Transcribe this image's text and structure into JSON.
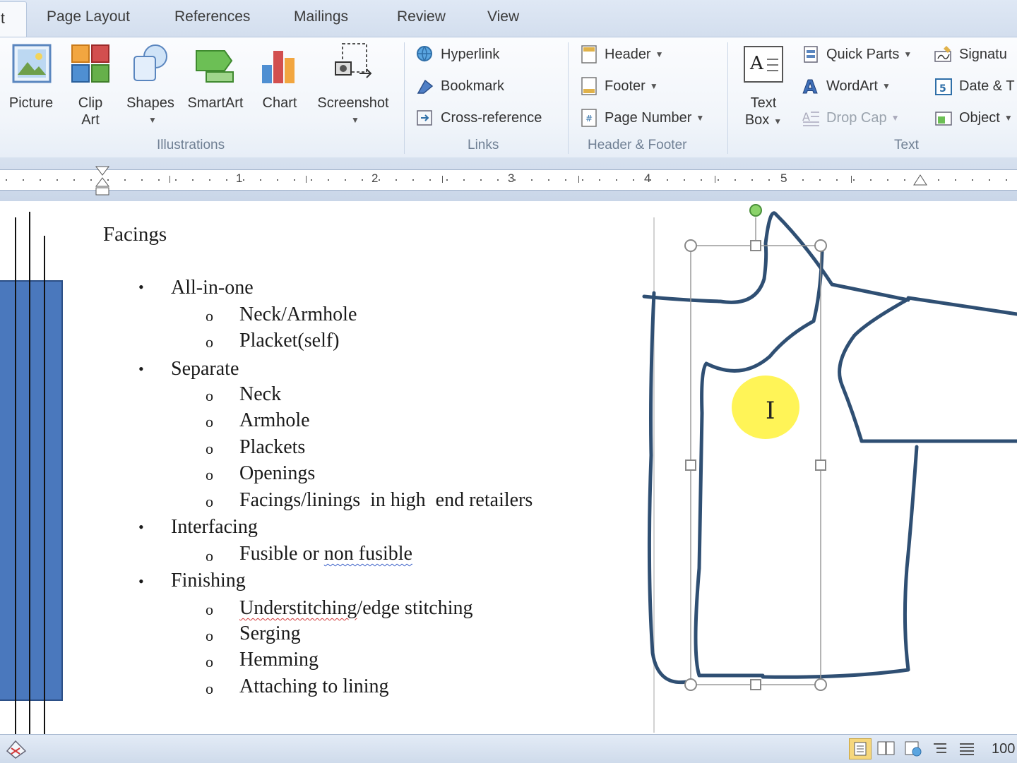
{
  "tabs": {
    "active": "t",
    "items": [
      "Page Layout",
      "References",
      "Mailings",
      "Review",
      "View"
    ]
  },
  "ribbon": {
    "illustrations": {
      "label": "Illustrations",
      "picture": "Picture",
      "clipart_1": "Clip",
      "clipart_2": "Art",
      "shapes": "Shapes",
      "smartart": "SmartArt",
      "chart": "Chart",
      "screenshot": "Screenshot"
    },
    "links": {
      "label": "Links",
      "hyperlink": "Hyperlink",
      "bookmark": "Bookmark",
      "crossref": "Cross-reference"
    },
    "header_footer": {
      "label": "Header & Footer",
      "header": "Header",
      "footer": "Footer",
      "page_number": "Page Number"
    },
    "text": {
      "label": "Text",
      "textbox_1": "Text",
      "textbox_2": "Box",
      "quick_parts": "Quick Parts",
      "wordart": "WordArt",
      "drop_cap": "Drop Cap",
      "signature": "Signatu",
      "date": "Date & T",
      "object": "Object"
    }
  },
  "ruler": {
    "numbers": [
      "1",
      "2",
      "3",
      "4",
      "5"
    ]
  },
  "document": {
    "heading": "Facings",
    "items": [
      {
        "level": 1,
        "text": "All-in-one"
      },
      {
        "level": 2,
        "text": "Neck/Armhole"
      },
      {
        "level": 2,
        "text": "Placket(self)"
      },
      {
        "level": 1,
        "text": "Separate"
      },
      {
        "level": 2,
        "text": "Neck"
      },
      {
        "level": 2,
        "text": "Armhole"
      },
      {
        "level": 2,
        "text": "Plackets"
      },
      {
        "level": 2,
        "text": "Openings"
      },
      {
        "level": 2,
        "text": "Facings/linings  in high  end retailers"
      },
      {
        "level": 1,
        "text": "Interfacing"
      },
      {
        "level": 2,
        "text_a": "Fusible or ",
        "text_b": "non fusible"
      },
      {
        "level": 1,
        "text": "Finishing"
      },
      {
        "level": 2,
        "text_a": "Understitching",
        "text_b": "/edge stitching"
      },
      {
        "level": 2,
        "text": "Serging"
      },
      {
        "level": 2,
        "text": "Hemming"
      },
      {
        "level": 2,
        "text": "Attaching to lining"
      }
    ],
    "bullet_l1": "•",
    "bullet_l2": "o"
  },
  "statusbar": {
    "zoom": "100"
  },
  "colors": {
    "sketch_stroke": "#2f4f73",
    "side_bar_fill": "#4a78bd",
    "highlight": "#fff23a",
    "handle_green": "#8bd36a"
  }
}
